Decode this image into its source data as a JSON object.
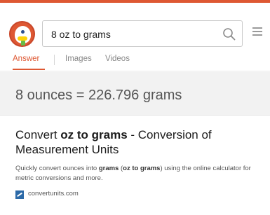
{
  "brand": {
    "logo": "duckduckgo-logo",
    "accent_color": "#de5833"
  },
  "search": {
    "value": "8 oz to grams",
    "icon": "search-icon",
    "menu_icon": "hamburger-menu-icon"
  },
  "tabs": [
    {
      "label": "Answer",
      "active": true
    },
    {
      "label": "Images",
      "active": false
    },
    {
      "label": "Videos",
      "active": false
    }
  ],
  "answer": {
    "text": "8 ounces = 226.796 grams"
  },
  "results": [
    {
      "title_parts": [
        "Convert ",
        "oz to grams",
        " - Conversion of Measurement Units"
      ],
      "snippet_parts": [
        "Quickly convert ounces into ",
        "grams",
        " (",
        "oz to grams",
        ") using the online calculator for metric conversions and more."
      ],
      "source": "convertunits.com",
      "favicon_color": "#2c6aa8"
    }
  ]
}
